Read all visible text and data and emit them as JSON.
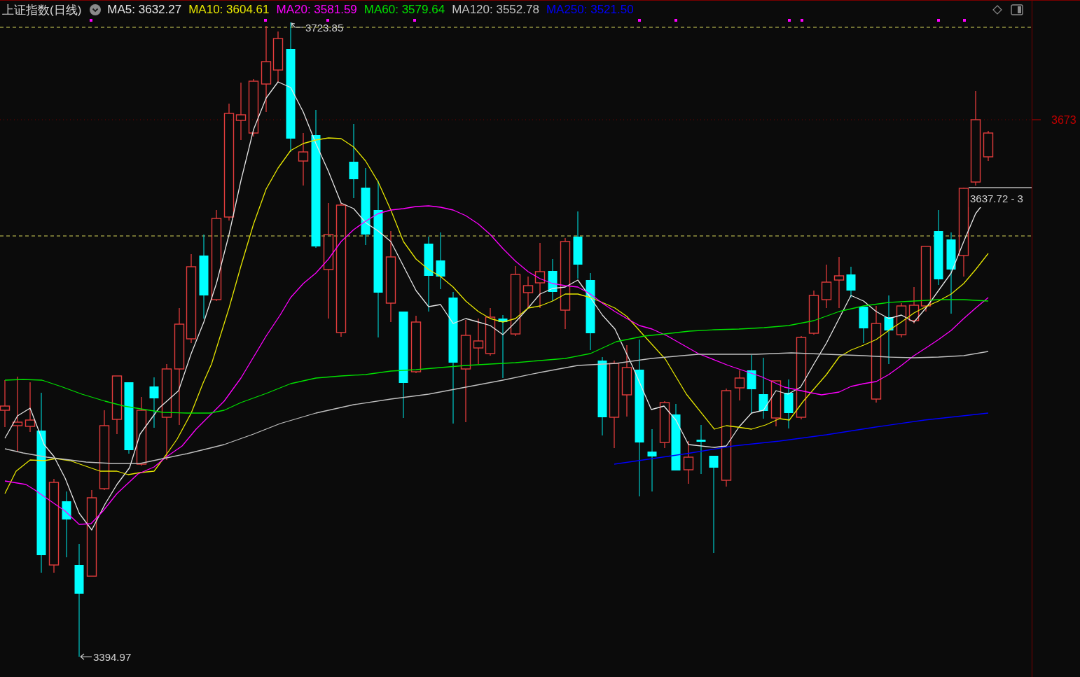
{
  "header": {
    "title": "上证指数(日线)",
    "indicators": [
      {
        "label": "MA5: 3632.27",
        "color": "#e6e6e6"
      },
      {
        "label": "MA10: 3604.61",
        "color": "#e6e600"
      },
      {
        "label": "MA20: 3581.59",
        "color": "#ff00ff"
      },
      {
        "label": "MA60: 3579.64",
        "color": "#00e000"
      },
      {
        "label": "MA120: 3552.78",
        "color": "#c0c0c0"
      },
      {
        "label": "MA250: 3521.50",
        "color": "#0000ff"
      }
    ]
  },
  "chart": {
    "annotations": [
      {
        "kind": "high",
        "text": "3723.85"
      },
      {
        "kind": "low",
        "text": "3394.97"
      }
    ],
    "price_tag": "3637.72 - 3"
  },
  "price_axis": {
    "labels": [
      "3673"
    ]
  }
}
